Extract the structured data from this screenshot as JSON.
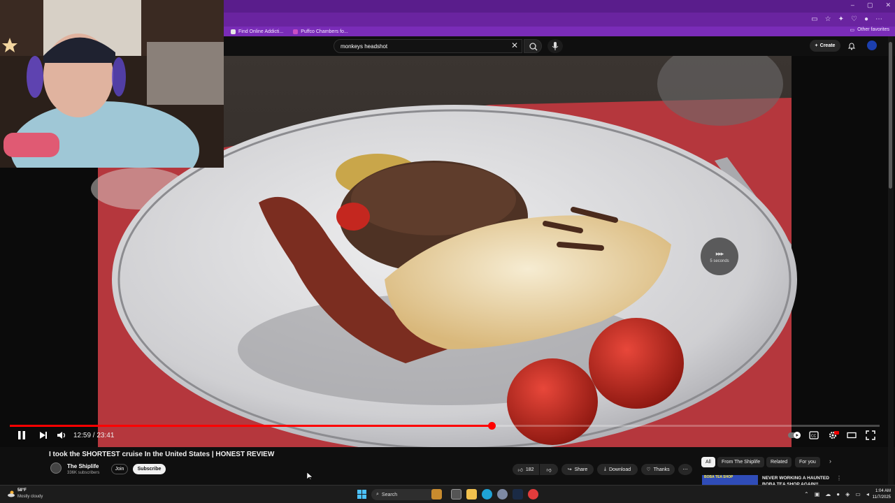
{
  "browser": {
    "window_controls": [
      "–",
      "▢",
      "✕"
    ],
    "bookmarks": [
      {
        "label": "Find Online Addicti...",
        "icon": "bookmark-favicon"
      },
      {
        "label": "Puffco Chambers fo...",
        "icon": "bookmark-favicon"
      }
    ],
    "other_favorites": "Other favorites"
  },
  "youtube_header": {
    "search_value": "monkeys headshot",
    "create_label": "Create"
  },
  "video": {
    "skip_label": "5 seconds",
    "progress_fraction": 0.5535,
    "current_time": "12:59",
    "duration": "23:41",
    "time_display": "12:59 / 23:41",
    "title": "I took the SHORTEST cruise In the United States | HONEST REVIEW",
    "channel_name": "The Shiplife",
    "channel_subs": "336K subscribers",
    "join_label": "Join",
    "subscribe_label": "Subscribe",
    "like_count": "182",
    "share_label": "Share",
    "download_label": "Download",
    "thanks_label": "Thanks"
  },
  "chips": {
    "all": "All",
    "from_channel": "From The Shiplife",
    "related": "Related",
    "for_you": "For you"
  },
  "recommendation": {
    "title": "NEVER WORKING A HAUNTED BOBA TEA SHOP AGAIN!!",
    "thumb_text": "BOBA TEA SHOP"
  },
  "taskbar": {
    "weather_temp": "58°F",
    "weather_desc": "Mostly cloudy",
    "search_label": "Search",
    "time": "1:04 AM",
    "date": "11/7/2025"
  },
  "colors": {
    "browser_purple": "#5a1d8c",
    "progress_red": "#ff0000",
    "youtube_bg": "#0f0f0f"
  }
}
